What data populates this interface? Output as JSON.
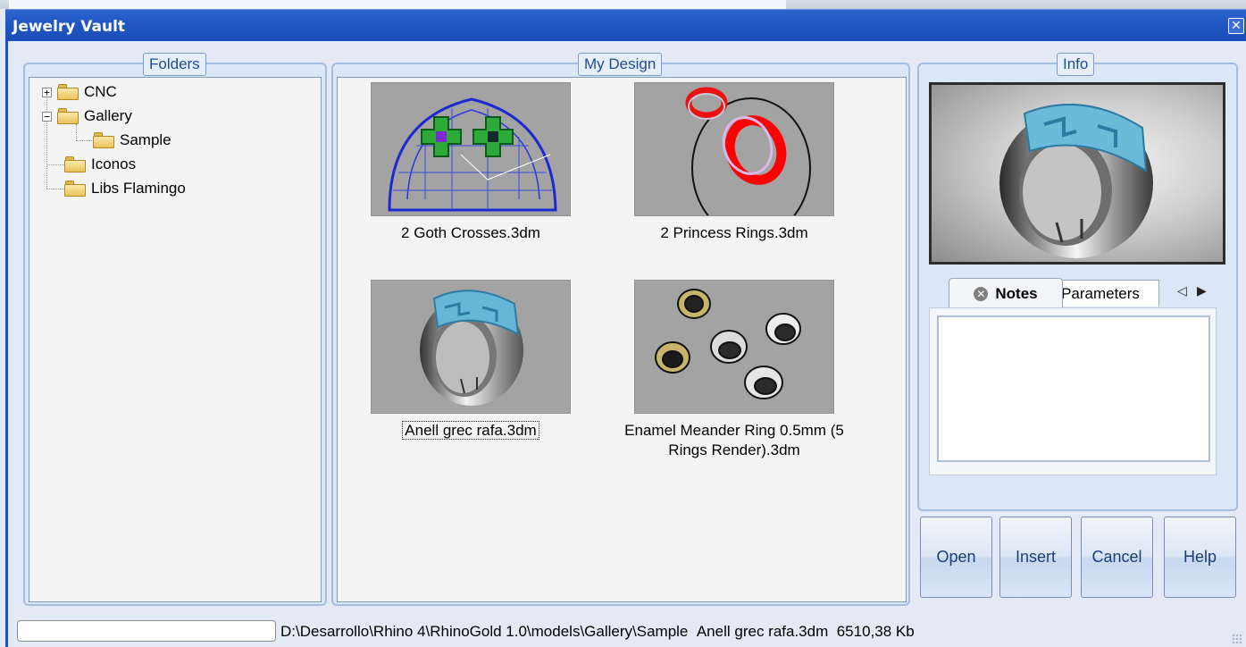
{
  "window": {
    "title": "Jewelry Vault",
    "close_glyph": "✕"
  },
  "folders": {
    "legend": "Folders",
    "tree": [
      {
        "label": "CNC",
        "expander": "+",
        "level": 0
      },
      {
        "label": "Gallery",
        "expander": "−",
        "level": 0
      },
      {
        "label": "Sample",
        "expander": "",
        "level": 1
      },
      {
        "label": "Iconos",
        "expander": "",
        "level": 0
      },
      {
        "label": "Libs Flamingo",
        "expander": "",
        "level": 0
      }
    ]
  },
  "design": {
    "legend": "My Design",
    "items": [
      {
        "name": "2 Goth Crosses.3dm",
        "thumbnail": "goth-crosses-wireframe"
      },
      {
        "name": "2 Princess Rings.3dm",
        "thumbnail": "princess-rings-render"
      },
      {
        "name": "Anell grec rafa.3dm",
        "thumbnail": "greek-ring-render",
        "selected": true
      },
      {
        "name": "Enamel Meander Ring 0.5mm (5 Rings Render).3dm",
        "thumbnail": "five-rings-render"
      }
    ]
  },
  "info": {
    "legend": "Info",
    "preview": "greek-ring-preview",
    "tabs": {
      "notes_label": "Notes",
      "parameters_label": "Parameters",
      "prev_glyph": "◁",
      "next_glyph": "▶"
    },
    "notes_text": ""
  },
  "buttons": {
    "open": "Open",
    "insert": "Insert",
    "cancel": "Cancel",
    "help": "Help"
  },
  "status": {
    "path": "D:\\Desarrollo\\Rhino 4\\RhinoGold 1.0\\models\\Gallery\\Sample",
    "file": "Anell grec rafa.3dm",
    "size": "6510,38 Kb"
  },
  "colors": {
    "titlebar": "#2157c3",
    "group_border": "#a4bde0",
    "legend_text": "#1f4d91",
    "thumb_bg": "#a3a3a3"
  }
}
